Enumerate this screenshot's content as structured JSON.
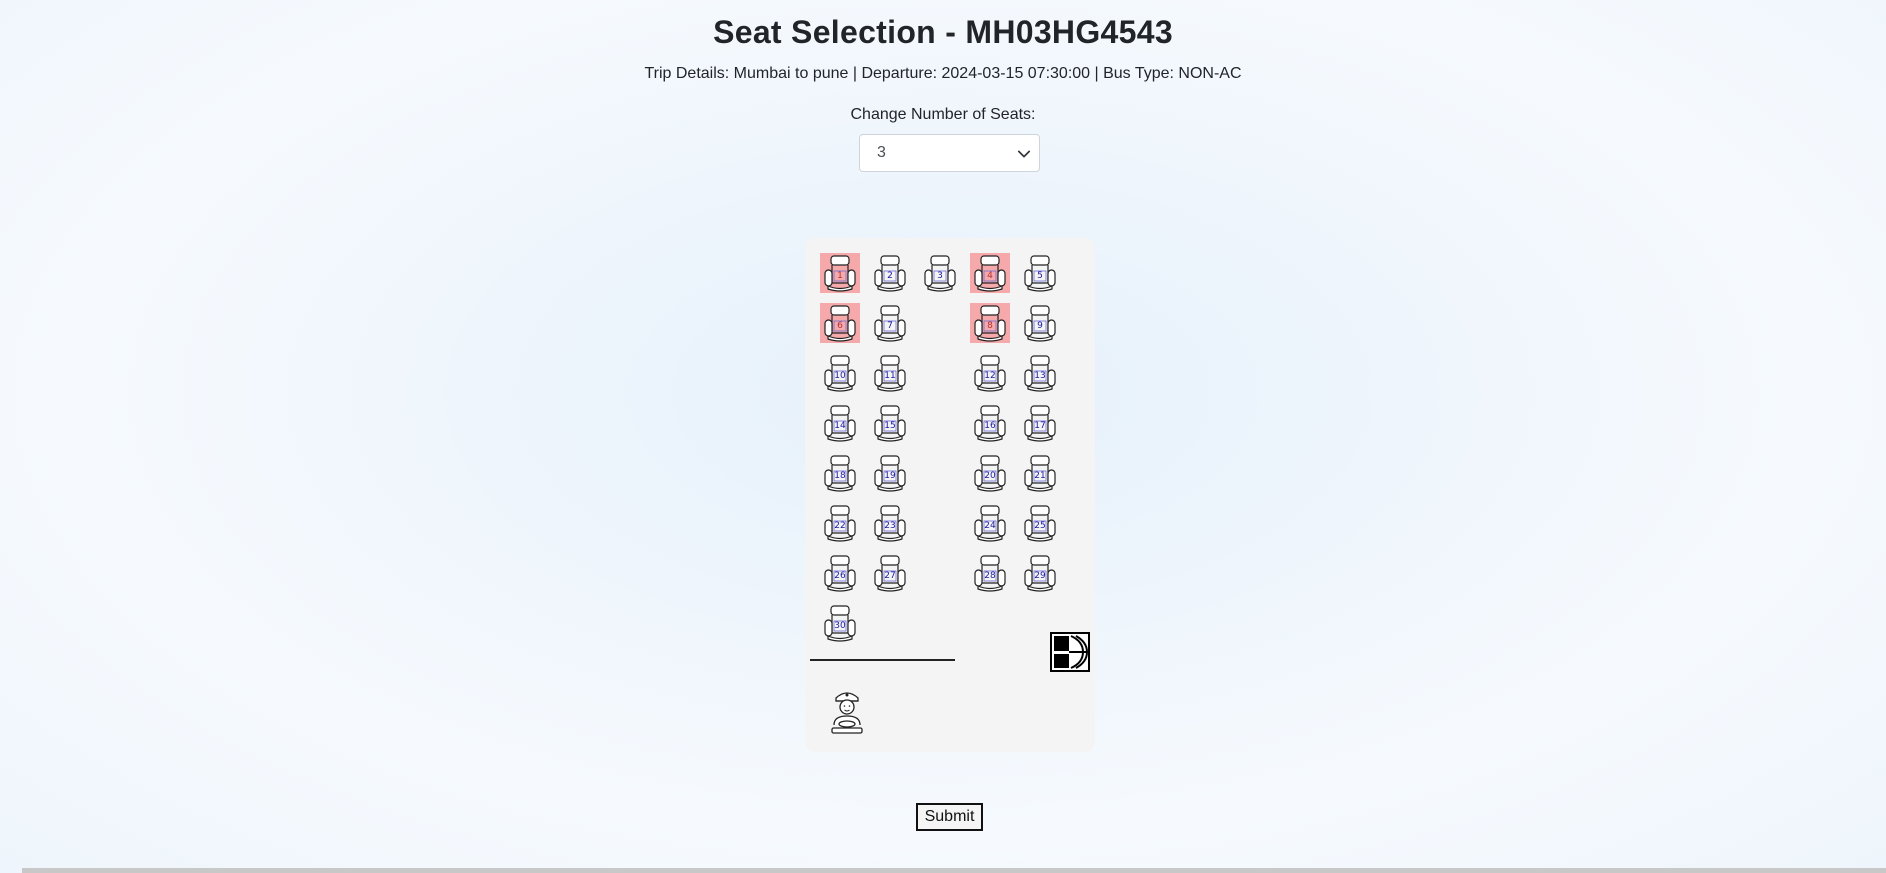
{
  "header": {
    "title": "Seat Selection - MH03HG4543",
    "trip_details": "Trip Details: Mumbai to pune | Departure: 2024-03-15 07:30:00 | Bus Type: NON-AC"
  },
  "seat_count": {
    "label": "Change Number of Seats:",
    "selected": "3"
  },
  "seat_rows": [
    [
      {
        "n": "1",
        "booked": true
      },
      {
        "n": "2",
        "booked": false
      },
      {
        "n": "3",
        "booked": false
      },
      {
        "n": "4",
        "booked": true
      },
      {
        "n": "5",
        "booked": false
      }
    ],
    [
      {
        "n": "6",
        "booked": true
      },
      {
        "n": "7",
        "booked": false
      },
      null,
      {
        "n": "8",
        "booked": true
      },
      {
        "n": "9",
        "booked": false
      }
    ],
    [
      {
        "n": "10",
        "booked": false
      },
      {
        "n": "11",
        "booked": false
      },
      null,
      {
        "n": "12",
        "booked": false
      },
      {
        "n": "13",
        "booked": false
      }
    ],
    [
      {
        "n": "14",
        "booked": false
      },
      {
        "n": "15",
        "booked": false
      },
      null,
      {
        "n": "16",
        "booked": false
      },
      {
        "n": "17",
        "booked": false
      }
    ],
    [
      {
        "n": "18",
        "booked": false
      },
      {
        "n": "19",
        "booked": false
      },
      null,
      {
        "n": "20",
        "booked": false
      },
      {
        "n": "21",
        "booked": false
      }
    ],
    [
      {
        "n": "22",
        "booked": false
      },
      {
        "n": "23",
        "booked": false
      },
      null,
      {
        "n": "24",
        "booked": false
      },
      {
        "n": "25",
        "booked": false
      }
    ],
    [
      {
        "n": "26",
        "booked": false
      },
      {
        "n": "27",
        "booked": false
      },
      null,
      {
        "n": "28",
        "booked": false
      },
      {
        "n": "29",
        "booked": false
      }
    ],
    [
      {
        "n": "30",
        "booked": false
      },
      null,
      null,
      null,
      null
    ]
  ],
  "colors": {
    "booked_seat": "#f6a9ab",
    "seat_number": "#1a1aa6",
    "bus_background": "#f4f4f4"
  },
  "icons": {
    "seat": "seat-icon",
    "door": "door-icon",
    "driver": "driver-icon",
    "dropdown": "chevron-down-icon"
  },
  "actions": {
    "submit_label": "Submit"
  }
}
